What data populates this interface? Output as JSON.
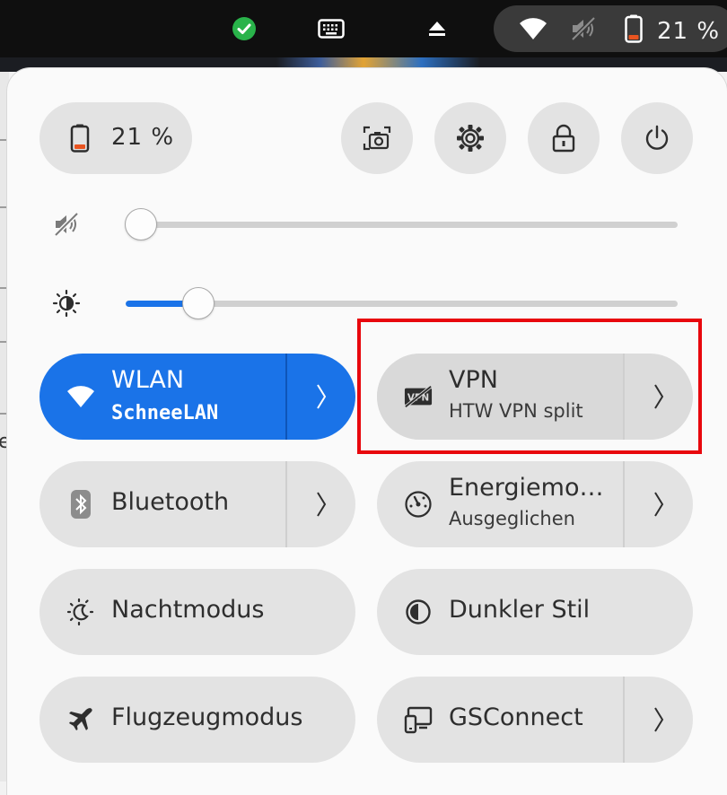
{
  "topbar": {
    "indicators": [
      {
        "icon": "check-circle-icon",
        "color": "#29b34a"
      },
      {
        "icon": "keyboard-icon"
      },
      {
        "icon": "eject-icon"
      }
    ],
    "status_icons": [
      "wifi-icon",
      "speaker-muted-icon",
      "battery-low-icon"
    ],
    "battery_percent": "21 %"
  },
  "quick_settings": {
    "battery_label": "21 %",
    "action_buttons": [
      "screenshot-icon",
      "settings-gear-icon",
      "lock-icon",
      "power-icon"
    ],
    "volume": {
      "icon": "speaker-muted-icon",
      "level": 0.0
    },
    "brightness": {
      "icon": "brightness-icon",
      "level": 0.11
    },
    "tiles": [
      {
        "title": "WLAN",
        "subtitle": "SchneeLAN",
        "icon": "wifi-icon",
        "active": true,
        "has_arrow": true
      },
      {
        "title": "VPN",
        "subtitle": "HTW VPN split",
        "icon": "vpn-icon",
        "active": false,
        "has_arrow": true
      },
      {
        "title": "Bluetooth",
        "icon": "bluetooth-icon",
        "active": false,
        "has_arrow": true
      },
      {
        "title": "Energiemo…",
        "subtitle": "Ausgeglichen",
        "icon": "power-profile-icon",
        "active": false,
        "has_arrow": true
      },
      {
        "title": "Nachtmodus",
        "icon": "night-light-icon",
        "active": false,
        "has_arrow": false
      },
      {
        "title": "Dunkler Stil",
        "icon": "dark-style-icon",
        "active": false,
        "has_arrow": false
      },
      {
        "title": "Flugzeugmodus",
        "icon": "airplane-icon",
        "active": false,
        "has_arrow": false
      },
      {
        "title": "GSConnect",
        "icon": "gsconnect-icon",
        "active": false,
        "has_arrow": true
      }
    ]
  },
  "colors": {
    "accent": "#1a73e8",
    "highlight": "#e8070d",
    "battery_low": "#e95420"
  },
  "background_text": "e"
}
